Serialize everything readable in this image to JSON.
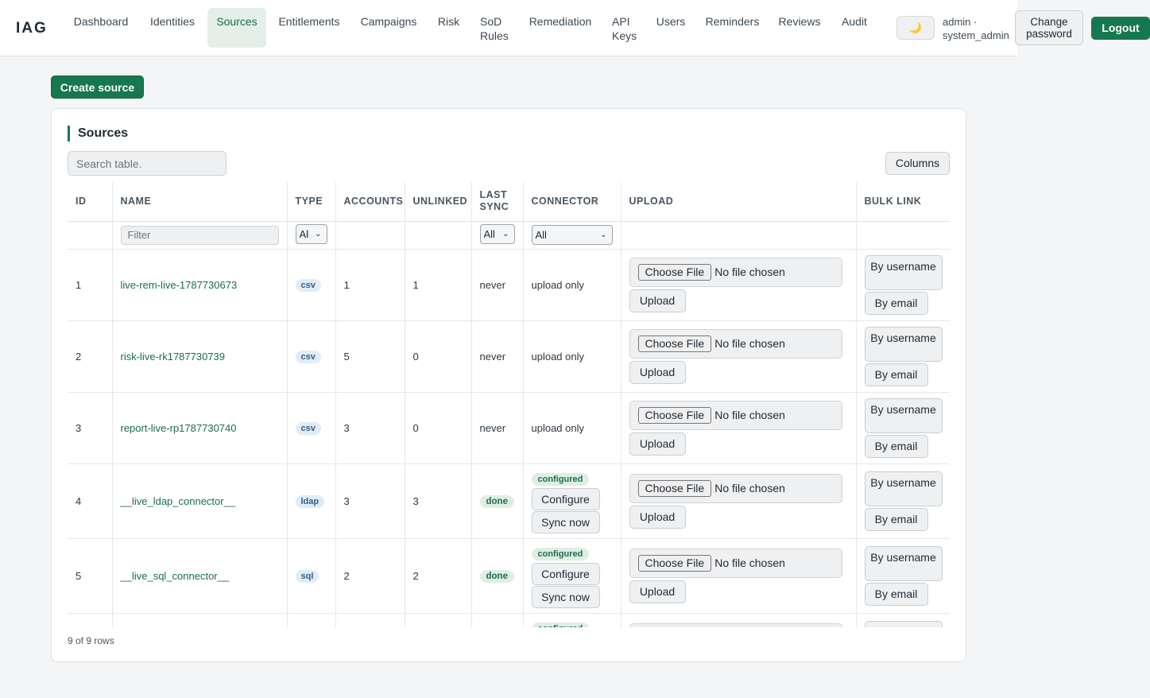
{
  "brand": "IAG",
  "nav": {
    "items": [
      {
        "label": "Dashboard"
      },
      {
        "label": "Identities"
      },
      {
        "label": "Sources"
      },
      {
        "label": "Entitlements"
      },
      {
        "label": "Campaigns"
      },
      {
        "label": "Risk"
      },
      {
        "label": "SoD Rules"
      },
      {
        "label": "Remediation"
      },
      {
        "label": "API Keys"
      },
      {
        "label": "Users"
      },
      {
        "label": "Reminders"
      },
      {
        "label": "Reviews"
      },
      {
        "label": "Audit"
      }
    ],
    "active": "Sources",
    "theme_icon": "moon-icon",
    "theme_glyph": "🌙",
    "user_line1": "admin ·",
    "user_line2": "system_admin",
    "change_password": "Change password",
    "logout": "Logout"
  },
  "page": {
    "create_button": "Create source",
    "card_title": "Sources",
    "search_placeholder": "Search table.",
    "columns_button": "Columns",
    "rows_count": "9 of 9 rows"
  },
  "table": {
    "headers": [
      "ID",
      "NAME",
      "TYPE",
      "ACCOUNTS",
      "UNLINKED",
      "LAST SYNC",
      "CONNECTOR",
      "UPLOAD",
      "BULK LINK"
    ],
    "filters": {
      "name_placeholder": "Filter",
      "type_value": "All",
      "last_sync_value": "All",
      "connector_value": "All"
    },
    "upload": {
      "choose_file": "Choose File",
      "no_file": "No file chosen",
      "upload_button": "Upload"
    },
    "bulk": {
      "by_username": "By username",
      "by_email": "By email"
    },
    "connector_actions": {
      "configure": "Configure",
      "sync_now": "Sync now"
    },
    "rows": [
      {
        "id": "1",
        "name": "live-rem-live-1787730673",
        "type": "csv",
        "accounts": "1",
        "unlinked": "1",
        "last_sync": "never",
        "connector": "upload only"
      },
      {
        "id": "2",
        "name": "risk-live-rk1787730739",
        "type": "csv",
        "accounts": "5",
        "unlinked": "0",
        "last_sync": "never",
        "connector": "upload only"
      },
      {
        "id": "3",
        "name": "report-live-rp1787730740",
        "type": "csv",
        "accounts": "3",
        "unlinked": "0",
        "last_sync": "never",
        "connector": "upload only"
      },
      {
        "id": "4",
        "name": "__live_ldap_connector__",
        "type": "ldap",
        "accounts": "3",
        "unlinked": "3",
        "last_sync": "done",
        "connector": "configured"
      },
      {
        "id": "5",
        "name": "__live_sql_connector__",
        "type": "sql",
        "accounts": "2",
        "unlinked": "2",
        "last_sync": "done",
        "connector": "configured"
      },
      {
        "id": "",
        "name": "",
        "type": "",
        "accounts": "",
        "unlinked": "",
        "last_sync": "",
        "connector": "configured"
      }
    ]
  }
}
